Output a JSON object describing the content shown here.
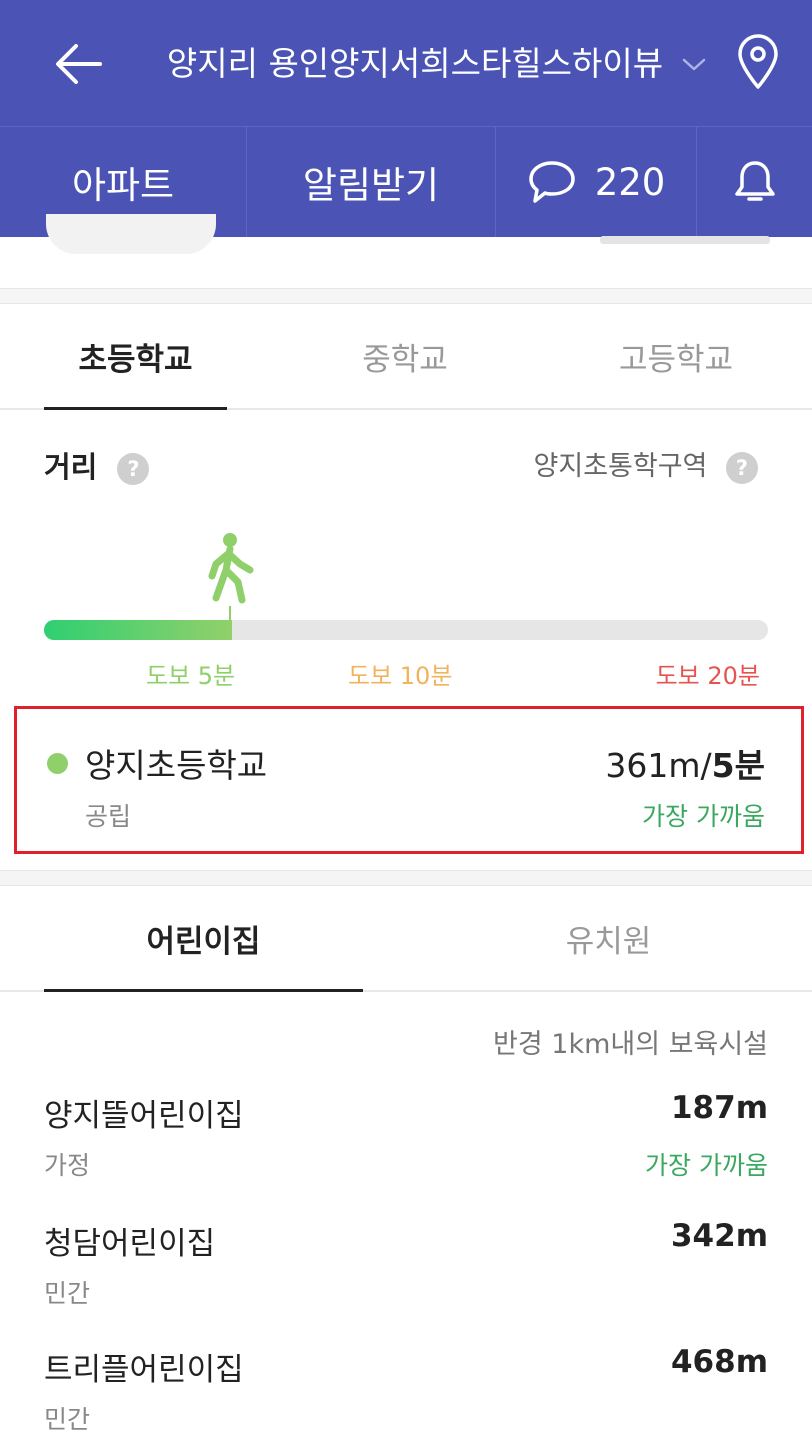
{
  "header": {
    "title": "양지리 용인양지서희스타힐스하이뷰",
    "back_icon": "arrow-left-icon",
    "dropdown_icon": "chevron-down-icon",
    "location_icon": "map-pin-icon",
    "background": "#4b54b4"
  },
  "nav": {
    "apartment": "아파트",
    "alert": "알림받기",
    "comments_count": "220",
    "comment_icon": "speech-bubble-icon",
    "bell_icon": "bell-icon"
  },
  "school_tabs": {
    "elementary": "초등학교",
    "middle": "중학교",
    "high": "고등학교",
    "active": "elementary"
  },
  "distance": {
    "label": "거리",
    "district": "양지초통학구역",
    "help": "?",
    "ticks": [
      "도보 5분",
      "도보 10분",
      "도보 20분"
    ],
    "tick_colors": [
      "#8fd06a",
      "#f2b35d",
      "#e5554f"
    ],
    "walker_icon": "walking-person-icon",
    "progress_percent": 26
  },
  "school": {
    "name": "양지초등학교",
    "type": "공립",
    "distance": "361m/",
    "walk_time": "5분",
    "note": "가장 가까움"
  },
  "care_tabs": {
    "daycare": "어린이집",
    "kindergarten": "유치원",
    "active": "daycare"
  },
  "radius_text": "반경 1km내의 보육시설",
  "facilities": [
    {
      "name": "양지뜰어린이집",
      "type": "가정",
      "distance": "187m",
      "note": "가장 가까움"
    },
    {
      "name": "청담어린이집",
      "type": "민간",
      "distance": "342m",
      "note": ""
    },
    {
      "name": "트리플어린이집",
      "type": "민간",
      "distance": "468m",
      "note": ""
    }
  ]
}
